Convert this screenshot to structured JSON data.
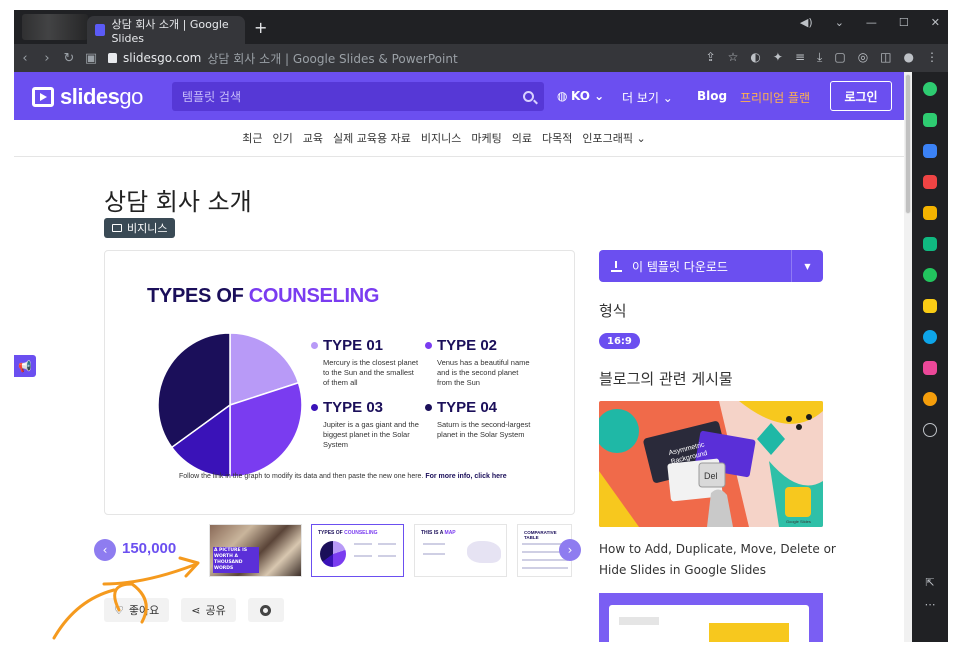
{
  "browser": {
    "tab_title": "상담 회사 소개 | Google Slides",
    "new_tab": "+",
    "url_domain": "slidesgo.com",
    "url_title": "상담 회사 소개 | Google Slides & PowerPoint"
  },
  "site": {
    "logo_main": "slides",
    "logo_go": "go",
    "search_placeholder": "템플릿 검색",
    "lang": "KO ⌄",
    "more": "더 보기 ⌄",
    "blog": "Blog",
    "premium": "프리미엄 플랜",
    "login": "로그인",
    "brand_color": "#6b4ff0"
  },
  "categories": [
    "최근",
    "인기",
    "교육",
    "실제 교육용 자료",
    "비지니스",
    "마케팅",
    "의료",
    "다목적",
    "인포그래픽 ⌄"
  ],
  "page": {
    "title": "상담 회사 소개",
    "category_badge": "비지니스"
  },
  "slide": {
    "title_part1": "TYPES OF ",
    "title_part2": "COUNSELING",
    "types": [
      {
        "h": "TYPE 01",
        "d": "Mercury is the closest planet to the Sun and the smallest of them all",
        "color": "#b89af7"
      },
      {
        "h": "TYPE 02",
        "d": "Venus has a beautiful name and is the second planet from the Sun",
        "color": "#7a3cf0"
      },
      {
        "h": "TYPE 03",
        "d": "Jupiter is a gas giant and the biggest planet in the Solar System",
        "color": "#3a12b8"
      },
      {
        "h": "TYPE 04",
        "d": "Saturn is the second-largest planet in the Solar System",
        "color": "#1b0f5a"
      }
    ],
    "footer_text": "Follow the link in the graph to modify its data and then paste the new one here. ",
    "footer_bold": "For more info, click here",
    "pie_shares": [
      0.2,
      0.3,
      0.15,
      0.35
    ]
  },
  "thumbs": {
    "count": "150,000",
    "photo_caption": "A PICTURE IS WORTH A THOUSAND WORDS",
    "sel_title1": "TYPES OF ",
    "sel_title2": "COUNSELING",
    "map_title1": "THIS IS A ",
    "map_title2": "MAP",
    "comp_title": "COMPARATIVE TABLE"
  },
  "actions": {
    "like": "좋아요",
    "share": "공유"
  },
  "right": {
    "download": "이 템플릿 다운로드",
    "format_label": "형식",
    "ratio": "16:9",
    "blog_label": "블로그의 관련 게시물",
    "blog_title": "How to Add, Duplicate, Move, Delete or Hide Slides in Google Slides",
    "blog_img_text1": "Asymmetric",
    "blog_img_text2": "Background",
    "blog_img_key": "Del",
    "blog_img_badge": "Google Slides"
  }
}
